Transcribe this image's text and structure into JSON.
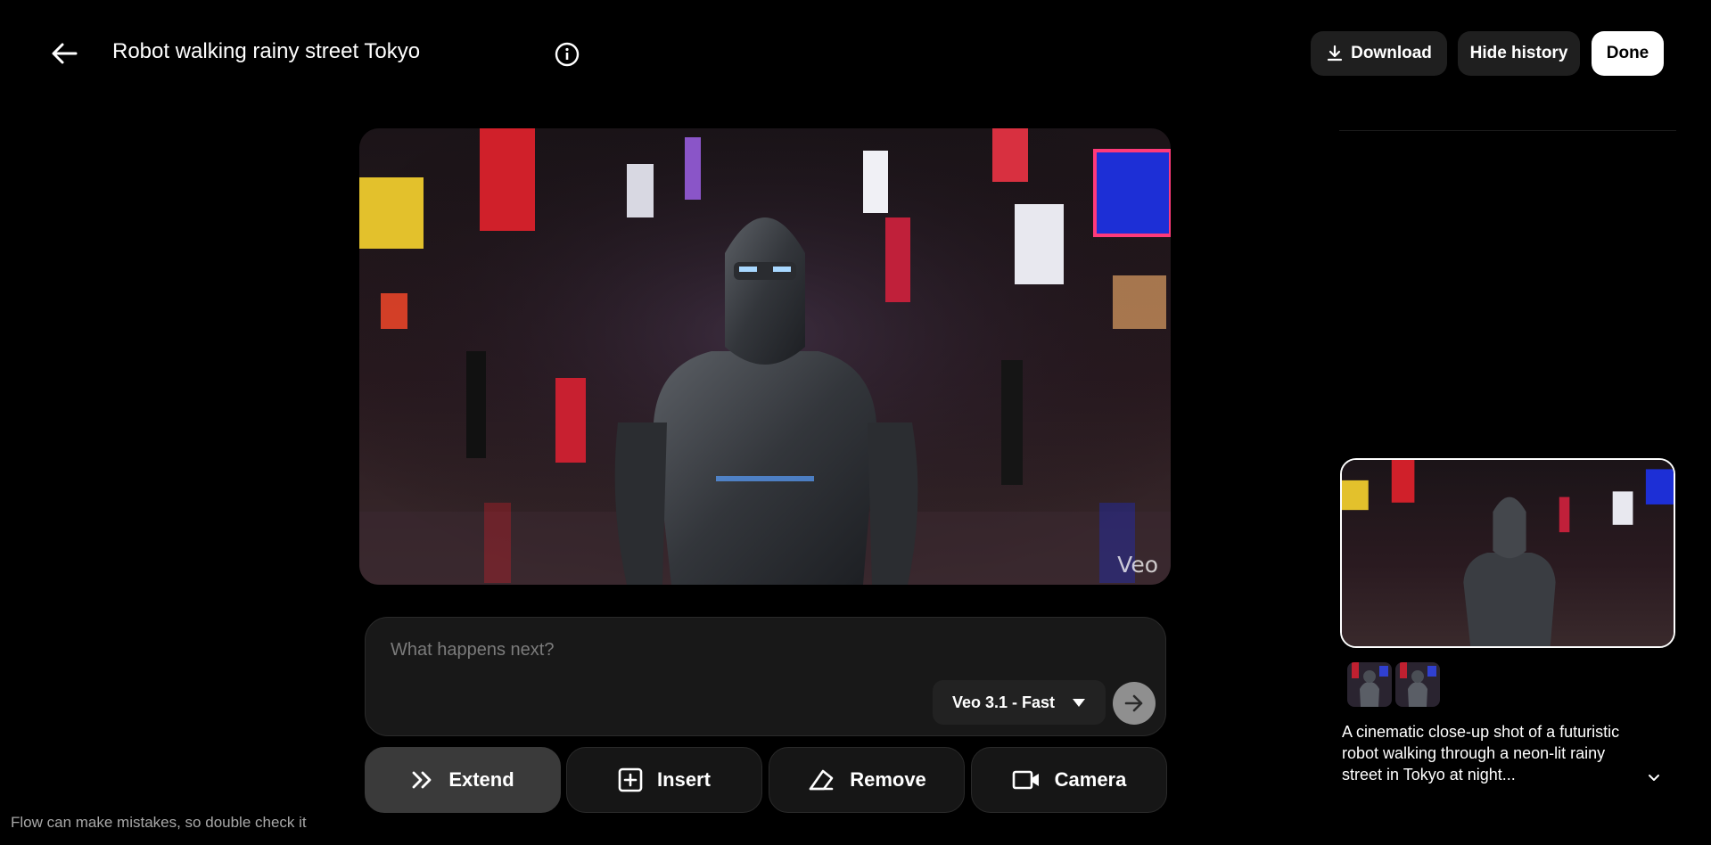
{
  "header": {
    "title": "Robot walking rainy street Tokyo",
    "download_label": "Download",
    "hide_history_label": "Hide history",
    "done_label": "Done"
  },
  "video": {
    "watermark": "Veo"
  },
  "prompt": {
    "placeholder": "What happens next?",
    "model_label": "Veo 3.1 - Fast"
  },
  "actions": [
    {
      "label": "Extend",
      "icon": "double-chevron-right-icon",
      "active": true
    },
    {
      "label": "Insert",
      "icon": "plus-square-icon",
      "active": false
    },
    {
      "label": "Remove",
      "icon": "eraser-icon",
      "active": false
    },
    {
      "label": "Camera",
      "icon": "video-camera-icon",
      "active": false
    }
  ],
  "footer": {
    "disclaimer": "Flow can make mistakes, so double check it"
  },
  "history": {
    "description": "A cinematic close-up shot of a futuristic robot walking through a neon-lit rainy street in Tokyo at night..."
  },
  "colors": {
    "background": "#000000",
    "surface": "#1f1f1f",
    "active_button": "#3a3a3a",
    "send_button": "#8f8f8f"
  }
}
